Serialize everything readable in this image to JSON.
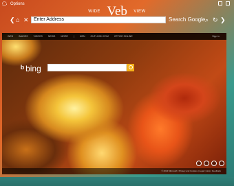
{
  "titlebar": {
    "options_label": "Options"
  },
  "logo": {
    "left": "WIDE",
    "center": "Veb",
    "right": "VIEW"
  },
  "address_bar": {
    "value": "Enter Address"
  },
  "search": {
    "label": "Search Google"
  },
  "bing": {
    "nav_items": [
      "WEB",
      "IMAGES",
      "VIDEOS",
      "NEWS",
      "MORE",
      "|",
      "MSN",
      "OUTLOOK.COM",
      "OFFICE ONLINE"
    ],
    "sign_in": "Sign in",
    "logo_text": "bing",
    "footer": "© 2014 Microsoft | Privacy and Cookies | Legal | Help | Feedback"
  },
  "colors": {
    "accent_left": "#c84a1e",
    "accent_right": "#2a7a74",
    "bing_search_button": "#f3b11a"
  }
}
